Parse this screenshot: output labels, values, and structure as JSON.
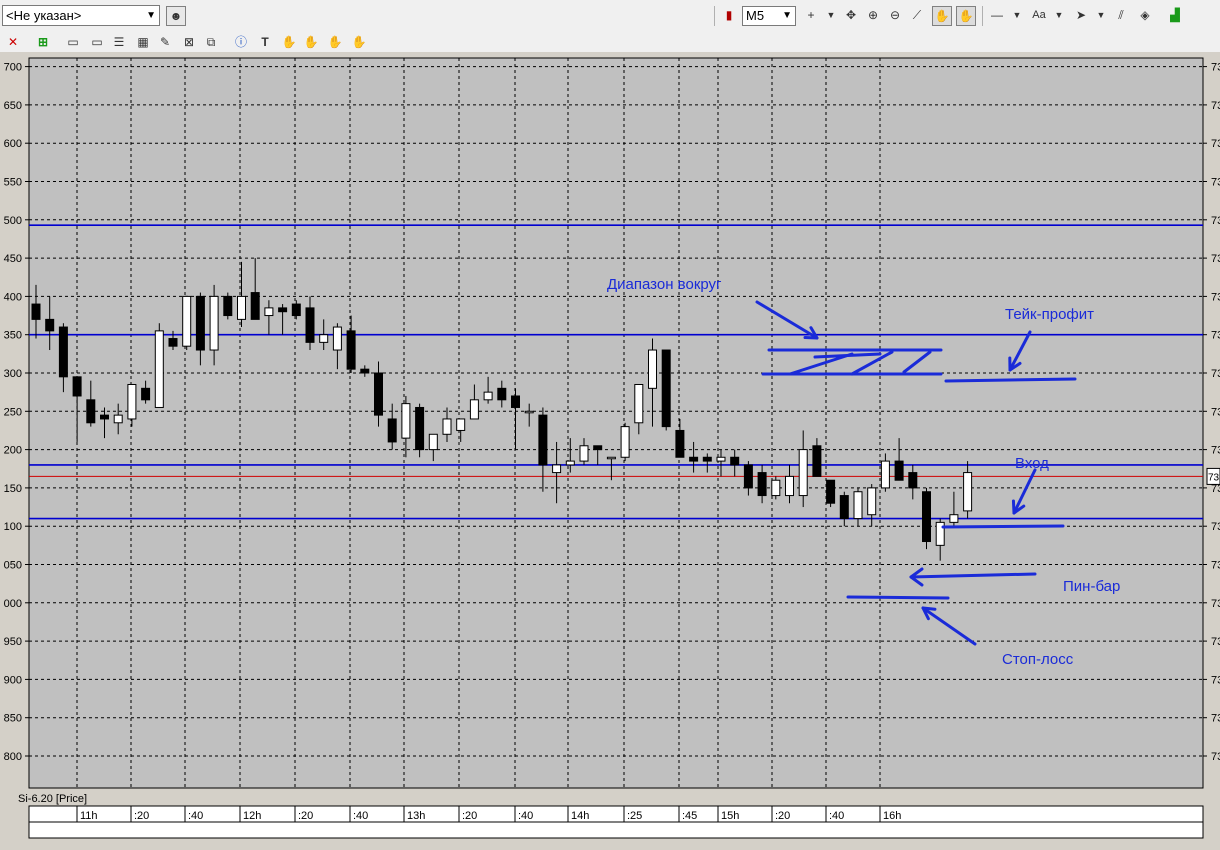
{
  "toolbar": {
    "account_select": "<Не указан>",
    "timeframe": "M5",
    "font_label": "Aa"
  },
  "chart_data": {
    "type": "candlestick",
    "instrument_label": "Si-6.20 [Price]",
    "y_ticks": [
      "800",
      "850",
      "900",
      "950",
      "000",
      "050",
      "100",
      "150",
      "200",
      "250",
      "300",
      "350",
      "400",
      "450",
      "500",
      "550",
      "600",
      "650",
      "700"
    ],
    "y_range": [
      792,
      752
    ],
    "right_tick_prefix": "73",
    "current_price_label": "73",
    "x_labels": [
      "11h",
      ":20",
      ":40",
      "12h",
      ":20",
      ":40",
      "13h",
      ":20",
      ":40",
      "14h",
      ":25",
      ":45",
      "15h",
      ":20",
      ":40",
      "16h"
    ],
    "candles": [
      [
        390,
        415,
        345,
        370
      ],
      [
        370,
        400,
        330,
        355
      ],
      [
        360,
        365,
        275,
        295
      ],
      [
        295,
        295,
        210,
        270
      ],
      [
        265,
        290,
        230,
        235
      ],
      [
        245,
        255,
        215,
        240
      ],
      [
        235,
        260,
        220,
        245
      ],
      [
        240,
        285,
        230,
        285
      ],
      [
        280,
        290,
        260,
        265
      ],
      [
        255,
        365,
        255,
        355
      ],
      [
        345,
        355,
        330,
        335
      ],
      [
        335,
        395,
        330,
        400
      ],
      [
        400,
        405,
        310,
        330
      ],
      [
        330,
        415,
        310,
        400
      ],
      [
        400,
        405,
        370,
        375
      ],
      [
        370,
        445,
        360,
        400
      ],
      [
        405,
        450,
        375,
        370
      ],
      [
        375,
        395,
        350,
        385
      ],
      [
        385,
        390,
        350,
        380
      ],
      [
        390,
        395,
        370,
        375
      ],
      [
        385,
        400,
        330,
        340
      ],
      [
        340,
        370,
        330,
        350
      ],
      [
        330,
        365,
        305,
        360
      ],
      [
        355,
        375,
        300,
        305
      ],
      [
        305,
        310,
        295,
        300
      ],
      [
        300,
        315,
        230,
        245
      ],
      [
        240,
        260,
        200,
        210
      ],
      [
        215,
        270,
        190,
        260
      ],
      [
        255,
        260,
        190,
        200
      ],
      [
        200,
        220,
        185,
        220
      ],
      [
        220,
        255,
        210,
        240
      ],
      [
        225,
        240,
        210,
        240
      ],
      [
        240,
        285,
        240,
        265
      ],
      [
        265,
        295,
        260,
        275
      ],
      [
        280,
        290,
        255,
        265
      ],
      [
        270,
        280,
        200,
        255
      ],
      [
        250,
        260,
        230,
        250
      ],
      [
        245,
        255,
        145,
        180
      ],
      [
        170,
        210,
        130,
        180
      ],
      [
        180,
        215,
        170,
        185
      ],
      [
        185,
        215,
        180,
        205
      ],
      [
        205,
        205,
        180,
        200
      ],
      [
        190,
        190,
        160,
        190
      ],
      [
        190,
        235,
        185,
        230
      ],
      [
        235,
        280,
        220,
        285
      ],
      [
        280,
        345,
        230,
        330
      ],
      [
        330,
        330,
        225,
        230
      ],
      [
        225,
        240,
        195,
        190
      ],
      [
        190,
        210,
        170,
        185
      ],
      [
        190,
        195,
        170,
        185
      ],
      [
        185,
        200,
        165,
        190
      ],
      [
        190,
        200,
        165,
        180
      ],
      [
        180,
        185,
        140,
        150
      ],
      [
        170,
        180,
        130,
        140
      ],
      [
        140,
        165,
        135,
        160
      ],
      [
        140,
        180,
        130,
        165
      ],
      [
        140,
        225,
        125,
        200
      ],
      [
        205,
        215,
        165,
        165
      ],
      [
        160,
        160,
        125,
        130
      ],
      [
        140,
        145,
        100,
        110
      ],
      [
        110,
        150,
        100,
        145
      ],
      [
        115,
        155,
        100,
        150
      ],
      [
        150,
        195,
        145,
        185
      ],
      [
        185,
        215,
        160,
        160
      ],
      [
        170,
        180,
        135,
        150
      ],
      [
        145,
        150,
        70,
        80
      ],
      [
        75,
        110,
        55,
        105
      ],
      [
        105,
        145,
        100,
        115
      ],
      [
        120,
        185,
        110,
        170
      ]
    ],
    "horizontal_lines": [
      {
        "value": 493,
        "color": "#0000d0"
      },
      {
        "value": 350,
        "color": "#0000d0"
      },
      {
        "value": 180,
        "color": "#0000d0"
      },
      {
        "value": 110,
        "color": "#0000d0"
      },
      {
        "value": 165,
        "color": "#d00000"
      }
    ],
    "annotations": [
      {
        "text": "Диапазон вокруг",
        "price": 285,
        "color": "#1a2bd8"
      },
      {
        "text": "Тейк-профит",
        "price": 310,
        "color": "#1a2bd8"
      },
      {
        "text": "Вход",
        "price": 210,
        "color": "#1a2bd8"
      },
      {
        "text": "Пин-бар",
        "price": 55,
        "color": "#1a2bd8"
      },
      {
        "text": "Стоп-лосс",
        "price": 955,
        "color": "#1a2bd8"
      }
    ],
    "colors": {
      "background": "#c0c0c0",
      "bull": "#ffffff",
      "bear": "#000000",
      "grid": "#000000",
      "annotation": "#1a2bd8"
    }
  }
}
